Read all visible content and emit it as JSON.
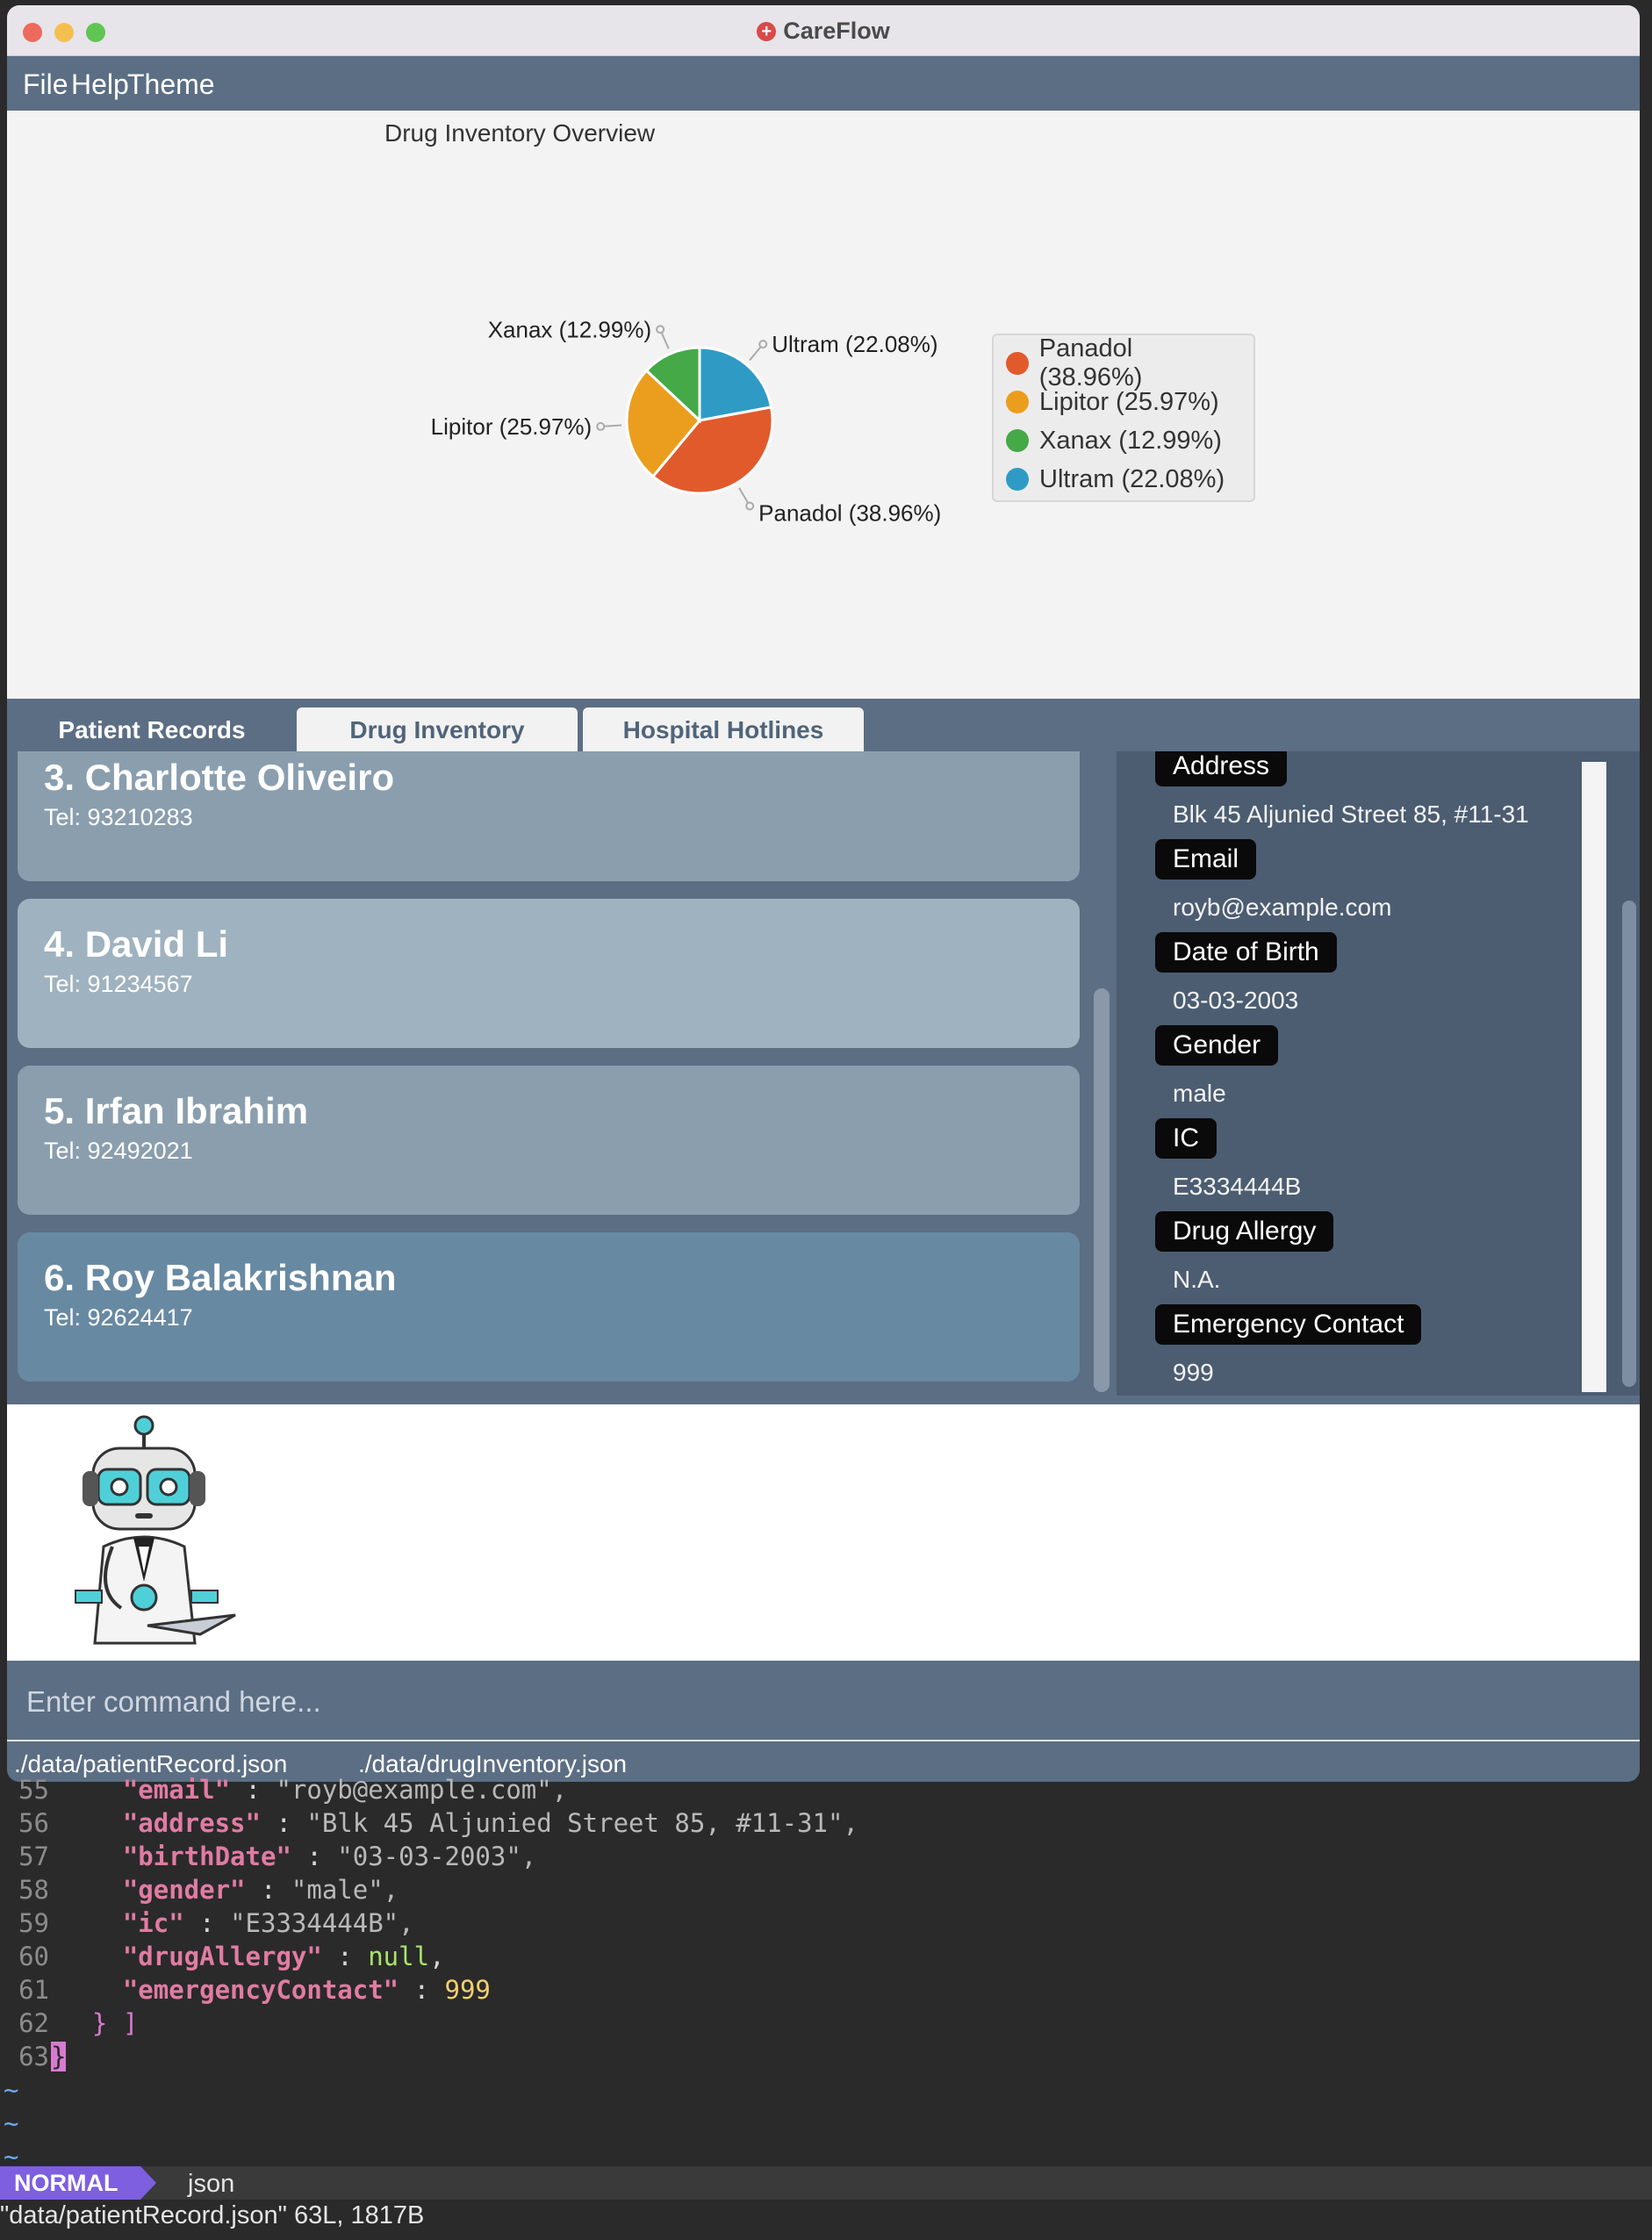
{
  "window": {
    "title": "CareFlow",
    "icon": "red-cross-icon"
  },
  "menu": [
    "File",
    "Help",
    "Theme"
  ],
  "chart_data": {
    "type": "pie",
    "title": "Drug Inventory Overview",
    "slices": [
      {
        "label": "Panadol (38.96%)",
        "value": 38.96,
        "color": "#e15a2c"
      },
      {
        "label": "Lipitor (25.97%)",
        "value": 25.97,
        "color": "#eb9e1d"
      },
      {
        "label": "Xanax (12.99%)",
        "value": 12.99,
        "color": "#44a946"
      },
      {
        "label": "Ultram (22.08%)",
        "value": 22.08,
        "color": "#2f9bc5"
      }
    ],
    "legend": [
      "Panadol (38.96%)",
      "Lipitor (25.97%)",
      "Xanax (12.99%)",
      "Ultram (22.08%)"
    ],
    "legend_position": "right"
  },
  "tabs": [
    {
      "label": "Patient Records",
      "active": true
    },
    {
      "label": "Drug Inventory",
      "active": false
    },
    {
      "label": "Hospital Hotlines",
      "active": false
    }
  ],
  "patients": [
    {
      "name": "3.  Charlotte Oliveiro",
      "tel": "Tel: 93210283",
      "color": "#8a9eae"
    },
    {
      "name": "4.  David Li",
      "tel": "Tel: 91234567",
      "color": "#9fb2bf"
    },
    {
      "name": "5.  Irfan Ibrahim",
      "tel": "Tel: 92492021",
      "color": "#8a9eae"
    },
    {
      "name": "6.  Roy Balakrishnan",
      "tel": "Tel: 92624417",
      "color": "#6889a2"
    }
  ],
  "details": {
    "address_label": "Address",
    "address": "Blk 45 Aljunied Street 85, #11-31",
    "email_label": "Email",
    "email": "royb@example.com",
    "dob_label": "Date of Birth",
    "dob": "03-03-2003",
    "gender_label": "Gender",
    "gender": "male",
    "ic_label": "IC",
    "ic": "E3334444B",
    "allergy_label": "Drug Allergy",
    "allergy": "N.A.",
    "emergency_label": "Emergency Contact",
    "emergency": "999"
  },
  "command": {
    "placeholder": "Enter command here..."
  },
  "status": {
    "patient_file": "./data/patientRecord.json",
    "drug_file": "./data/drugInventory.json"
  },
  "terminal": {
    "lines": [
      {
        "no": "55",
        "key": "\"email\"",
        "sep": " : ",
        "val": "\"royb@example.com\",",
        "vt": "str"
      },
      {
        "no": "56",
        "key": "\"address\"",
        "sep": " : ",
        "val": "\"Blk 45 Aljunied Street 85, #11-31\",",
        "vt": "str"
      },
      {
        "no": "57",
        "key": "\"birthDate\"",
        "sep": " : ",
        "val": "\"03-03-2003\",",
        "vt": "str"
      },
      {
        "no": "58",
        "key": "\"gender\"",
        "sep": " : ",
        "val": "\"male\",",
        "vt": "str"
      },
      {
        "no": "59",
        "key": "\"ic\"",
        "sep": " : ",
        "val": "\"E3334444B\",",
        "vt": "str"
      },
      {
        "no": "60",
        "key": "\"drugAllergy\"",
        "sep": " : ",
        "val": "null",
        "vt": "nul",
        "tail": ","
      },
      {
        "no": "61",
        "key": "\"emergencyContact\"",
        "sep": " : ",
        "val": "999",
        "vt": "num"
      }
    ],
    "line62_no": "62",
    "line62": "} ]",
    "line63_no": "63",
    "line63": "}",
    "tilde": "~",
    "mode": "NORMAL",
    "filetype": "json",
    "message": "\"data/patientRecord.json\" 63L, 1817B"
  }
}
